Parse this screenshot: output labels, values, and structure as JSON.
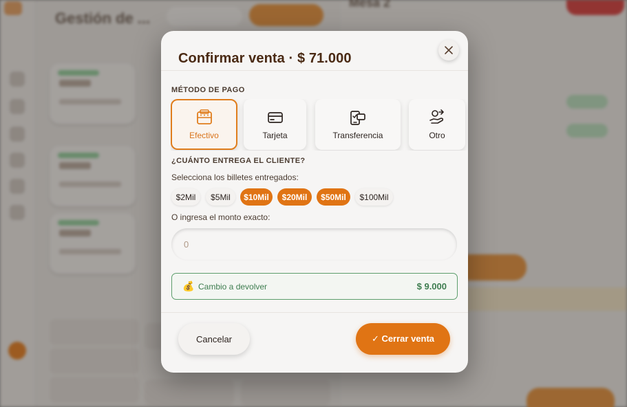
{
  "background": {
    "app_title": "Gestión de ...",
    "right_title": "Mesa 2"
  },
  "modal": {
    "title": "Confirmar venta · $ 71.000",
    "close_icon": "close-icon",
    "payment_section_label": "MÉTODO DE PAGO",
    "payment_methods": [
      {
        "label": "Efectivo",
        "icon": "cash-register-icon",
        "selected": true
      },
      {
        "label": "Tarjeta",
        "icon": "credit-card-icon",
        "selected": false
      },
      {
        "label": "Transferencia",
        "icon": "mobile-transfer-icon",
        "selected": false
      },
      {
        "label": "Otro",
        "icon": "hand-money-icon",
        "selected": false
      }
    ],
    "cash_section_label": "¿CUÁNTO ENTREGA EL CLIENTE?",
    "bills_hint": "Selecciona los billetes entregados:",
    "bills": [
      {
        "label": "$2Mil",
        "selected": false
      },
      {
        "label": "$5Mil",
        "selected": false
      },
      {
        "label": "$10Mil",
        "selected": true
      },
      {
        "label": "$20Mil",
        "selected": true
      },
      {
        "label": "$50Mil",
        "selected": true
      },
      {
        "label": "$100Mil",
        "selected": false
      }
    ],
    "exact_hint": "O ingresa el monto exacto:",
    "amount_input": {
      "value": "",
      "placeholder": "0"
    },
    "change": {
      "icon": "money-bag-icon",
      "label": "Cambio a devolver",
      "value": "$ 9.000"
    },
    "cancel_label": "Cancelar",
    "confirm_label": "✓ Cerrar venta",
    "colors": {
      "accent": "#e07414",
      "success": "#3e7d50",
      "title": "#4a2a14"
    }
  }
}
